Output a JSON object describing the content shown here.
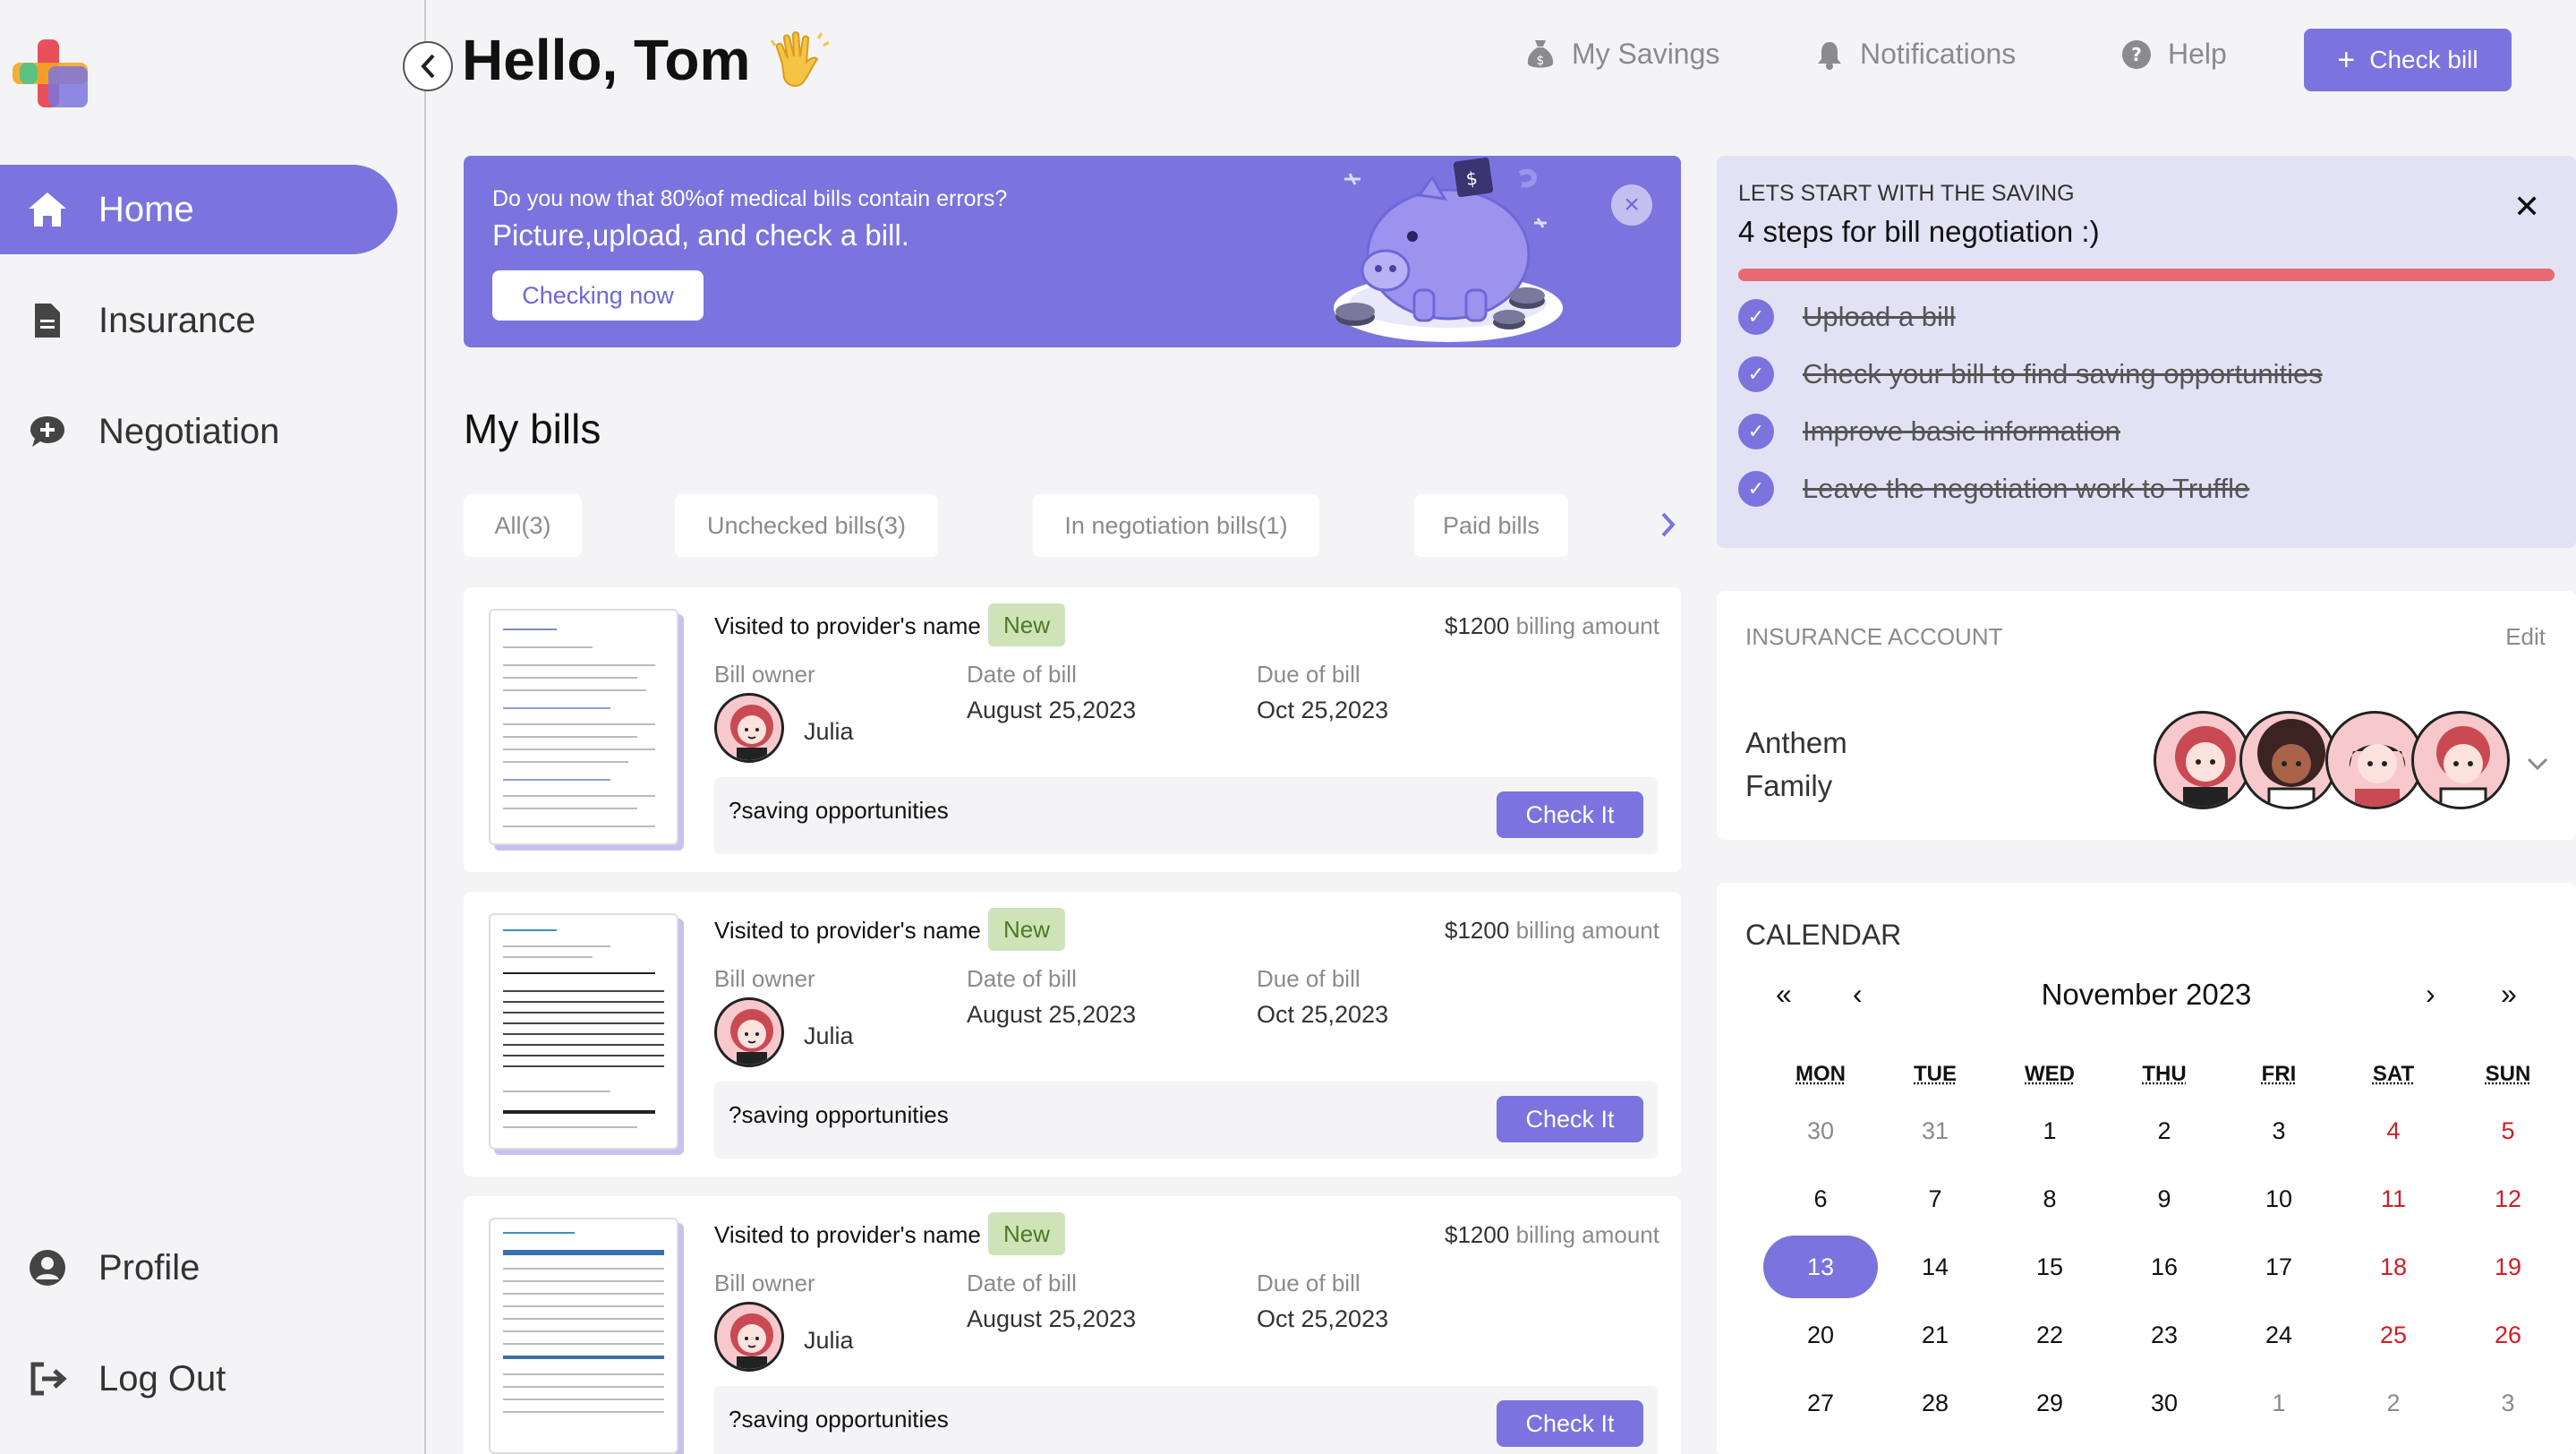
{
  "header": {
    "greeting": "Hello, Tom",
    "links": [
      "My Savings",
      "Notifications",
      "Help"
    ],
    "check_bill": "Check bill"
  },
  "sidebar": {
    "items": [
      {
        "label": "Home",
        "icon": "home-icon"
      },
      {
        "label": "Insurance",
        "icon": "document-icon"
      },
      {
        "label": "Negotiation",
        "icon": "chat-plus-icon"
      },
      {
        "label": "Profile",
        "icon": "user-icon"
      },
      {
        "label": "Log Out",
        "icon": "logout-icon"
      }
    ]
  },
  "banner": {
    "question": "Do you now that 80%of medical bills contain errors?",
    "tagline": "Picture,upload, and check a bill.",
    "button": "Checking now"
  },
  "bills": {
    "title": "My bills",
    "tabs": [
      "All(3)",
      "Unchecked bills(3)",
      "In negotiation bills(1)",
      "Paid bills"
    ],
    "items": [
      {
        "provider": "Visited to provider's name",
        "badge": "New",
        "amount": "$1200",
        "amount_suffix": "billing amount",
        "owner_label": "Bill owner",
        "owner": "Julia",
        "date_label": "Date of bill",
        "date": "August 25,2023",
        "due_label": "Due of bill",
        "due": "Oct 25,2023",
        "saving": "?saving opportunities",
        "button": "Check It"
      },
      {
        "provider": "Visited to provider's name",
        "badge": "New",
        "amount": "$1200",
        "amount_suffix": "billing amount",
        "owner_label": "Bill owner",
        "owner": "Julia",
        "date_label": "Date of bill",
        "date": "August 25,2023",
        "due_label": "Due of bill",
        "due": "Oct 25,2023",
        "saving": "?saving opportunities",
        "button": "Check It"
      },
      {
        "provider": "Visited to provider's name",
        "badge": "New",
        "amount": "$1200",
        "amount_suffix": "billing amount",
        "owner_label": "Bill owner",
        "owner": "Julia",
        "date_label": "Date of bill",
        "date": "August 25,2023",
        "due_label": "Due of bill",
        "due": "Oct 25,2023",
        "saving": "?saving opportunities",
        "button": "Check It"
      }
    ]
  },
  "steps": {
    "eyebrow": "LETS START WITH THE SAVING",
    "title": "4 steps for bill negotiation :)",
    "progress": 1.0,
    "items": [
      "Upload a bill",
      "Check your bill to find saving opportunities",
      "Improve basic information",
      "Leave the negotiation work to Truffle"
    ]
  },
  "insurance": {
    "title": "INSURANCE ACCOUNT",
    "edit": "Edit",
    "name_line1": "Anthem",
    "name_line2": "Family"
  },
  "calendar": {
    "title": "CALENDAR",
    "month": "November 2023",
    "nav": [
      "«",
      "‹",
      "›",
      "»"
    ],
    "weekdays": [
      "MON",
      "TUE",
      "WED",
      "THU",
      "FRI",
      "SAT",
      "SUN"
    ],
    "weeks": [
      [
        "30",
        "31",
        "1",
        "2",
        "3",
        "4",
        "5"
      ],
      [
        "6",
        "7",
        "8",
        "9",
        "10",
        "11",
        "12"
      ],
      [
        "13",
        "14",
        "15",
        "16",
        "17",
        "18",
        "19"
      ],
      [
        "20",
        "21",
        "22",
        "23",
        "24",
        "25",
        "26"
      ],
      [
        "27",
        "28",
        "29",
        "30",
        "1",
        "2",
        "3"
      ]
    ],
    "selected": "13"
  },
  "colors": {
    "accent": "#7b74de",
    "weekend": "#cc1f26",
    "badge_bg": "#cfe3b8",
    "progress": "#e66b73"
  }
}
